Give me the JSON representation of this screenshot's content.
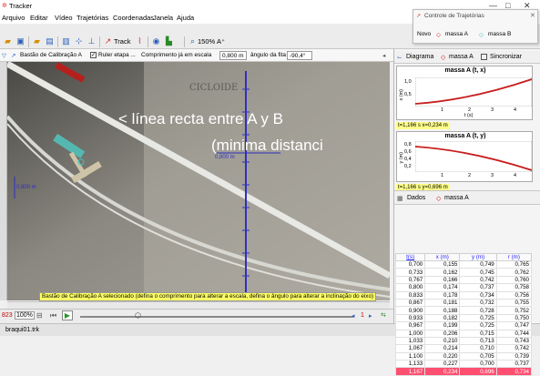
{
  "window": {
    "title": "Tracker",
    "controls": [
      "—",
      "□",
      "✕"
    ]
  },
  "menu": [
    "Arquivo",
    "Editar",
    "Vídeo",
    "Trajetórias",
    "Coordenadas",
    "Janela",
    "Ajuda"
  ],
  "toolbar": {
    "track_label": "Track",
    "zoom_label": "150%",
    "font_label": "A⁺"
  },
  "calibration": {
    "tool_name": "Bastão de Calibração A",
    "ruler_label": "Ruler etapa ...",
    "length_label": "Comprimento já em escala",
    "length_value": "0,800 m",
    "angle_label": "ângulo da fita",
    "angle_value": "-90,4°"
  },
  "video": {
    "overlay_line1": "< línea recta entre A y B",
    "overlay_line2": "(minima distanci",
    "scale_label": "0,800 m",
    "handwriting": "CICLOIDE",
    "ruler_ticks": [
      "0m",
      "1m",
      "2m",
      "3m",
      "4m",
      "5m",
      "6m",
      "7m",
      "8m"
    ]
  },
  "status_message": "Bastão de Calibração A selecionado (defina o comprimento para alterar a escala, defina o ângulo para alterar a inclinação do eixo)",
  "player": {
    "frame": "823",
    "zoom": "100%",
    "step": "1"
  },
  "file_tab": "braqui01.trk",
  "trajectory_control": {
    "title": "Controle de Trajetórias",
    "new_label": "Novo",
    "mass_a": "massa A",
    "mass_b": "massa B"
  },
  "plots": {
    "toolbar_label": "Diagrama",
    "track_label": "massa A",
    "sync_label": "Sincronizar",
    "plot1": {
      "title": "massa A (t, x)",
      "ylabel": "x (m)",
      "xlabel": "t (s)",
      "yticks": [
        "1,0",
        "0,5"
      ],
      "xticks": [
        "1",
        "2",
        "3",
        "4"
      ],
      "readout": "t=1,166 s  x=0,234 m"
    },
    "plot2": {
      "title": "massa A (t, y)",
      "ylabel": "y (m)",
      "yticks": [
        "0,8",
        "0,6",
        "0,4",
        "0,2"
      ],
      "xticks": [
        "1",
        "2",
        "3",
        "4"
      ],
      "readout": "t=1,166 s  y=0,696 m"
    }
  },
  "table": {
    "toolbar_label": "Dados",
    "track_label": "massa A",
    "headers": [
      "t(s)",
      "x (m)",
      "y (m)",
      "r (m)"
    ],
    "rows": [
      [
        "0,700",
        "0,155",
        "0,749",
        "0,765"
      ],
      [
        "0,733",
        "0,162",
        "0,745",
        "0,762"
      ],
      [
        "0,767",
        "0,166",
        "0,742",
        "0,760"
      ],
      [
        "0,800",
        "0,174",
        "0,737",
        "0,758"
      ],
      [
        "0,833",
        "0,178",
        "0,734",
        "0,756"
      ],
      [
        "0,867",
        "0,181",
        "0,732",
        "0,755"
      ],
      [
        "0,900",
        "0,188",
        "0,728",
        "0,752"
      ],
      [
        "0,933",
        "0,182",
        "0,725",
        "0,750"
      ],
      [
        "0,967",
        "0,199",
        "0,725",
        "0,747"
      ],
      [
        "1,000",
        "0,206",
        "0,715",
        "0,744"
      ],
      [
        "1,033",
        "0,210",
        "0,713",
        "0,743"
      ],
      [
        "1,067",
        "0,214",
        "0,710",
        "0,742"
      ],
      [
        "1,100",
        "0,220",
        "0,705",
        "0,739"
      ],
      [
        "1,133",
        "0,227",
        "0,700",
        "0,737"
      ],
      [
        "1,167",
        "0,234",
        "0,696",
        "0,734"
      ]
    ],
    "selected_row": 14
  },
  "colors": {
    "accent": "#2a61b8",
    "track": "#c81e1e",
    "selection": "#ff4f70",
    "status_bg": "#ffff66"
  }
}
